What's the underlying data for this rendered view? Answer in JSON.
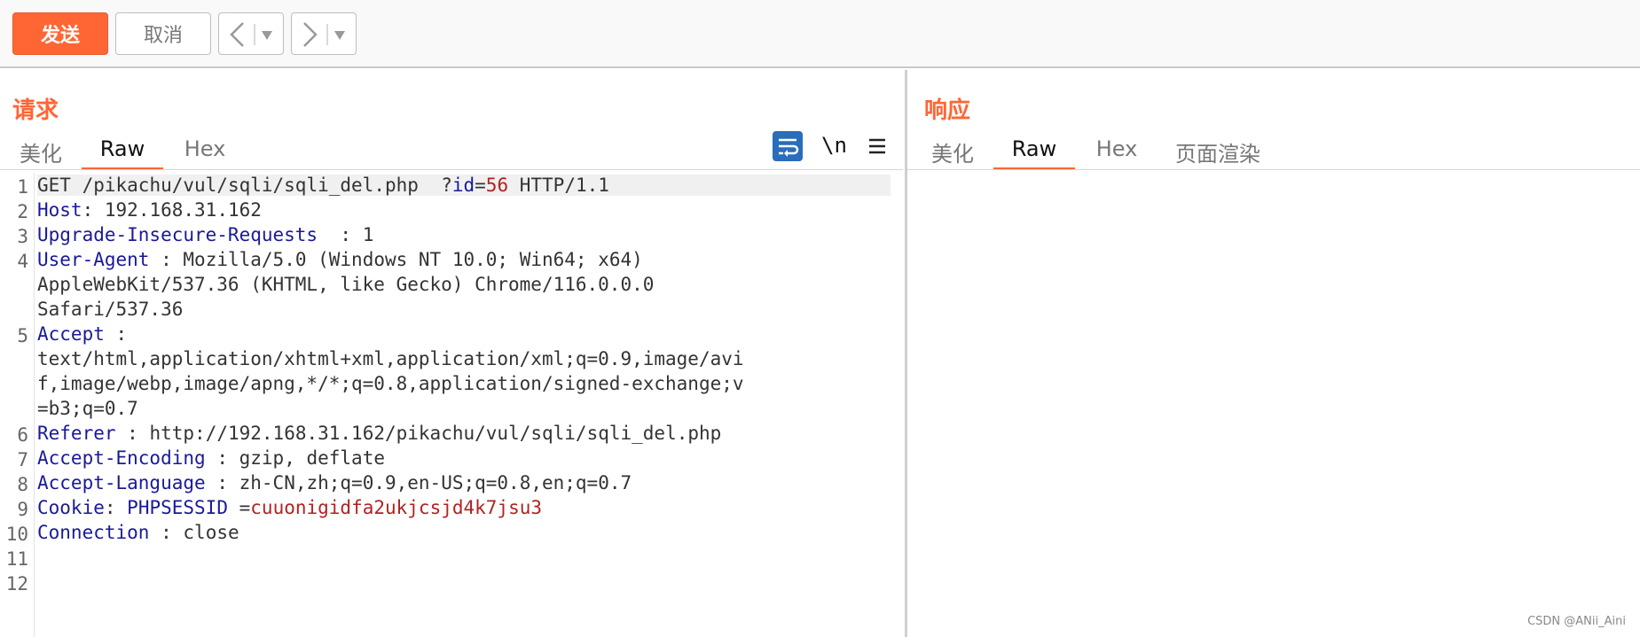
{
  "toolbar": {
    "send_label": "发送",
    "cancel_label": "取消"
  },
  "request": {
    "title": "请求",
    "tabs": [
      {
        "label": "美化",
        "active": false
      },
      {
        "label": "Raw",
        "active": true
      },
      {
        "label": "Hex",
        "active": false
      }
    ],
    "newline_label": "\\n",
    "line_numbers": [
      "1",
      "2",
      "3",
      "4",
      "5",
      "6",
      "7",
      "8",
      "9",
      "10",
      "11",
      "12"
    ],
    "lines": [
      {
        "method": "GET",
        "path": "/pikachu/vul/sqli/sqli_del.php",
        "q": "?",
        "param": "id",
        "eq": "=",
        "value": "56",
        "proto": "HTTP/1.1"
      },
      {
        "key": "Host",
        "sep": ":",
        "value": "192.168.31.162"
      },
      {
        "key": "Upgrade-Insecure-Requests",
        "sep": ":",
        "value": "1"
      },
      {
        "key": "User-Agent",
        "sep": ":",
        "value": "Mozilla/5.0 (Windows NT 10.0; Win64; x64)",
        "wrap1": "AppleWebKit/537.36 (KHTML, like Gecko) Chrome/116.0.0.0",
        "wrap2": "Safari/537.36"
      },
      {
        "key": "Accept",
        "sep": ":",
        "wrap1": "text/html,application/xhtml+xml,application/xml;q=0.9,image/avi",
        "wrap2": "f,image/webp,image/apng,*/*;q=0.8,application/signed-exchange;v",
        "wrap3": "=b3;q=0.7"
      },
      {
        "key": "Referer",
        "sep": ":",
        "value": "http://192.168.31.162/pikachu/vul/sqli/sqli_del.php"
      },
      {
        "key": "Accept-Encoding",
        "sep": ":",
        "value": "gzip, deflate"
      },
      {
        "key": "Accept-Language",
        "sep": ":",
        "value": "zh-CN,zh;q=0.9,en-US;q=0.8,en;q=0.7"
      },
      {
        "key": "Cookie",
        "sep": ":",
        "ckey": "PHPSESSID",
        "ceq": "=",
        "cval": "cuuonigidfa2ukjcsjd4k7jsu3"
      },
      {
        "key": "Connection",
        "sep": ":",
        "value": "close"
      }
    ]
  },
  "response": {
    "title": "响应",
    "tabs": [
      {
        "label": "美化",
        "active": false
      },
      {
        "label": "Raw",
        "active": true
      },
      {
        "label": "Hex",
        "active": false
      },
      {
        "label": "页面渲染",
        "active": false
      }
    ]
  },
  "watermark": "CSDN @ANii_Aini",
  "colors": {
    "accent": "#ff6633",
    "header_key": "#1a1a99",
    "param_value": "#b22222",
    "icon_bg": "#2a6ebb"
  }
}
